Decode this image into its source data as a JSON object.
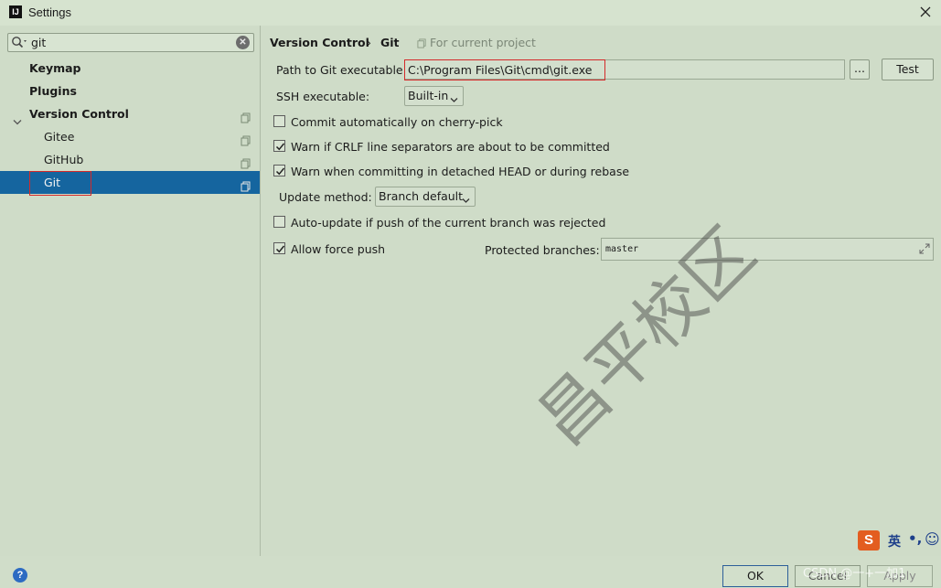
{
  "window": {
    "title": "Settings"
  },
  "search": {
    "value": "git"
  },
  "tree": {
    "keymap": "Keymap",
    "plugins": "Plugins",
    "version_control": "Version Control",
    "gitee": "Gitee",
    "github": "GitHub",
    "git": "Git"
  },
  "header": {
    "crumb1": "Version Control",
    "sep": "›",
    "crumb2": "Git",
    "scope": "For current project"
  },
  "git_settings": {
    "path_label": "Path to Git executable:",
    "path_value": "C:\\Program Files\\Git\\cmd\\git.exe",
    "browse_label": "...",
    "test_label": "Test",
    "ssh_label": "SSH executable:",
    "ssh_value": "Built-in",
    "commit_cherry_pick": "Commit automatically on cherry-pick",
    "warn_crlf": "Warn if CRLF line separators are about to be committed",
    "warn_detached": "Warn when committing in detached HEAD or during rebase",
    "update_method_label": "Update method:",
    "update_method_value": "Branch default",
    "auto_update": "Auto-update if push of the current branch was rejected",
    "allow_force_push": "Allow force push",
    "protected_label": "Protected branches:",
    "protected_value": "master"
  },
  "checkboxes": {
    "commit_cherry_pick": false,
    "warn_crlf": true,
    "warn_detached": true,
    "auto_update": false,
    "allow_force_push": true
  },
  "footer": {
    "ok": "OK",
    "cancel": "Cancel",
    "apply": "Apply"
  },
  "overlay": {
    "watermark": "昌平校区",
    "csdn": "CSDN @一+一加1",
    "ime_s": "S",
    "ime_lang": "英",
    "ime_punct": "•,",
    "ime_face": "☺"
  },
  "colors": {
    "selection": "#15659f",
    "highlight_box": "#d42a2a",
    "background": "#cfdcc8"
  }
}
